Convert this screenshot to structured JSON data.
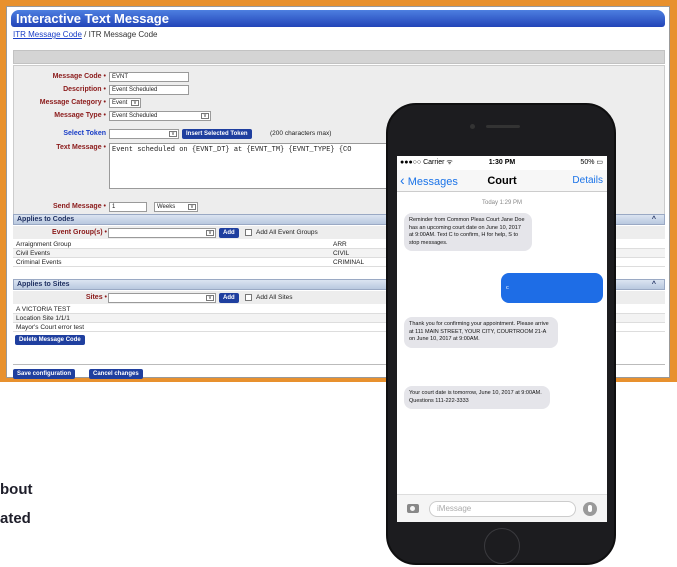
{
  "app": {
    "title": "Interactive Text Message",
    "breadcrumb_link": "ITR Message Code",
    "breadcrumb_rest": " / ITR Message Code"
  },
  "form": {
    "message_code": {
      "label": "Message Code",
      "value": "EVNT"
    },
    "description": {
      "label": "Description",
      "value": "Event Scheduled"
    },
    "message_category": {
      "label": "Message Category",
      "value": "Event"
    },
    "message_type": {
      "label": "Message Type",
      "value": "Event Scheduled"
    },
    "select_token": {
      "label": "Select Token",
      "button": "Insert Selected Token",
      "note": "(200 characters max)"
    },
    "text_message": {
      "label": "Text Message",
      "value": "Event scheduled on {EVNT_DT} at {EVNT_TM} {EVNT_TYPE} {CO"
    },
    "send_message": {
      "label": "Send Message",
      "value": "1",
      "unit": "Weeks"
    }
  },
  "codes": {
    "section": "Applies to Codes",
    "label": "Event Group(s)",
    "add": "Add",
    "add_all": "Add All Event Groups",
    "rows": [
      {
        "name": "Arraignment Group",
        "code": "ARR"
      },
      {
        "name": "Civil Events",
        "code": "CIVIL"
      },
      {
        "name": "Criminal Events",
        "code": "CRIMINAL"
      }
    ]
  },
  "sites": {
    "section": "Applies to Sites",
    "label": "Sites",
    "add": "Add",
    "add_all": "Add All Sites",
    "rows": [
      {
        "name": "A VICTORIA TEST"
      },
      {
        "name": "Location Site 1/1/1"
      },
      {
        "name": "Mayor's Court error test"
      }
    ],
    "delete": "Delete Message Code"
  },
  "actions": {
    "save": "Save configuration",
    "cancel": "Cancel changes"
  },
  "required_mark": "•",
  "caret": "^",
  "page_text": {
    "line1": "bout",
    "line2": "ated"
  },
  "phone": {
    "status_carrier": "●●●○○ Carrier ᯤ",
    "status_time": "1:30 PM",
    "status_battery": "50% ▭",
    "nav_back": "Messages",
    "nav_title": "Court",
    "nav_details": "Details",
    "timestamp": "Today 1:29 PM",
    "messages": [
      {
        "from": "in",
        "text": "Reminder from Common Pleas Court Jane Doe has an upcoming court date on June 10, 2017 at 9:00AM. Text C to confirm, H for help, S to stop messages."
      },
      {
        "from": "out",
        "text": "c"
      },
      {
        "from": "in",
        "text": "Thank you for confirming your appointment. Please arrive at 111 MAIN STREET, YOUR CITY, COURTROOM 21-A on June 10, 2017 at 9:00AM."
      },
      {
        "from": "in",
        "text": "Your court date is tomorrow, June 10, 2017 at 9:00AM. Questions 111-222-3333"
      }
    ],
    "compose_placeholder": "iMessage"
  },
  "colors": {
    "title_blue": "#2244b8",
    "label_red": "#8b1a1a",
    "frame_orange": "#e8912e",
    "bubble_blue": "#1e6de6"
  }
}
